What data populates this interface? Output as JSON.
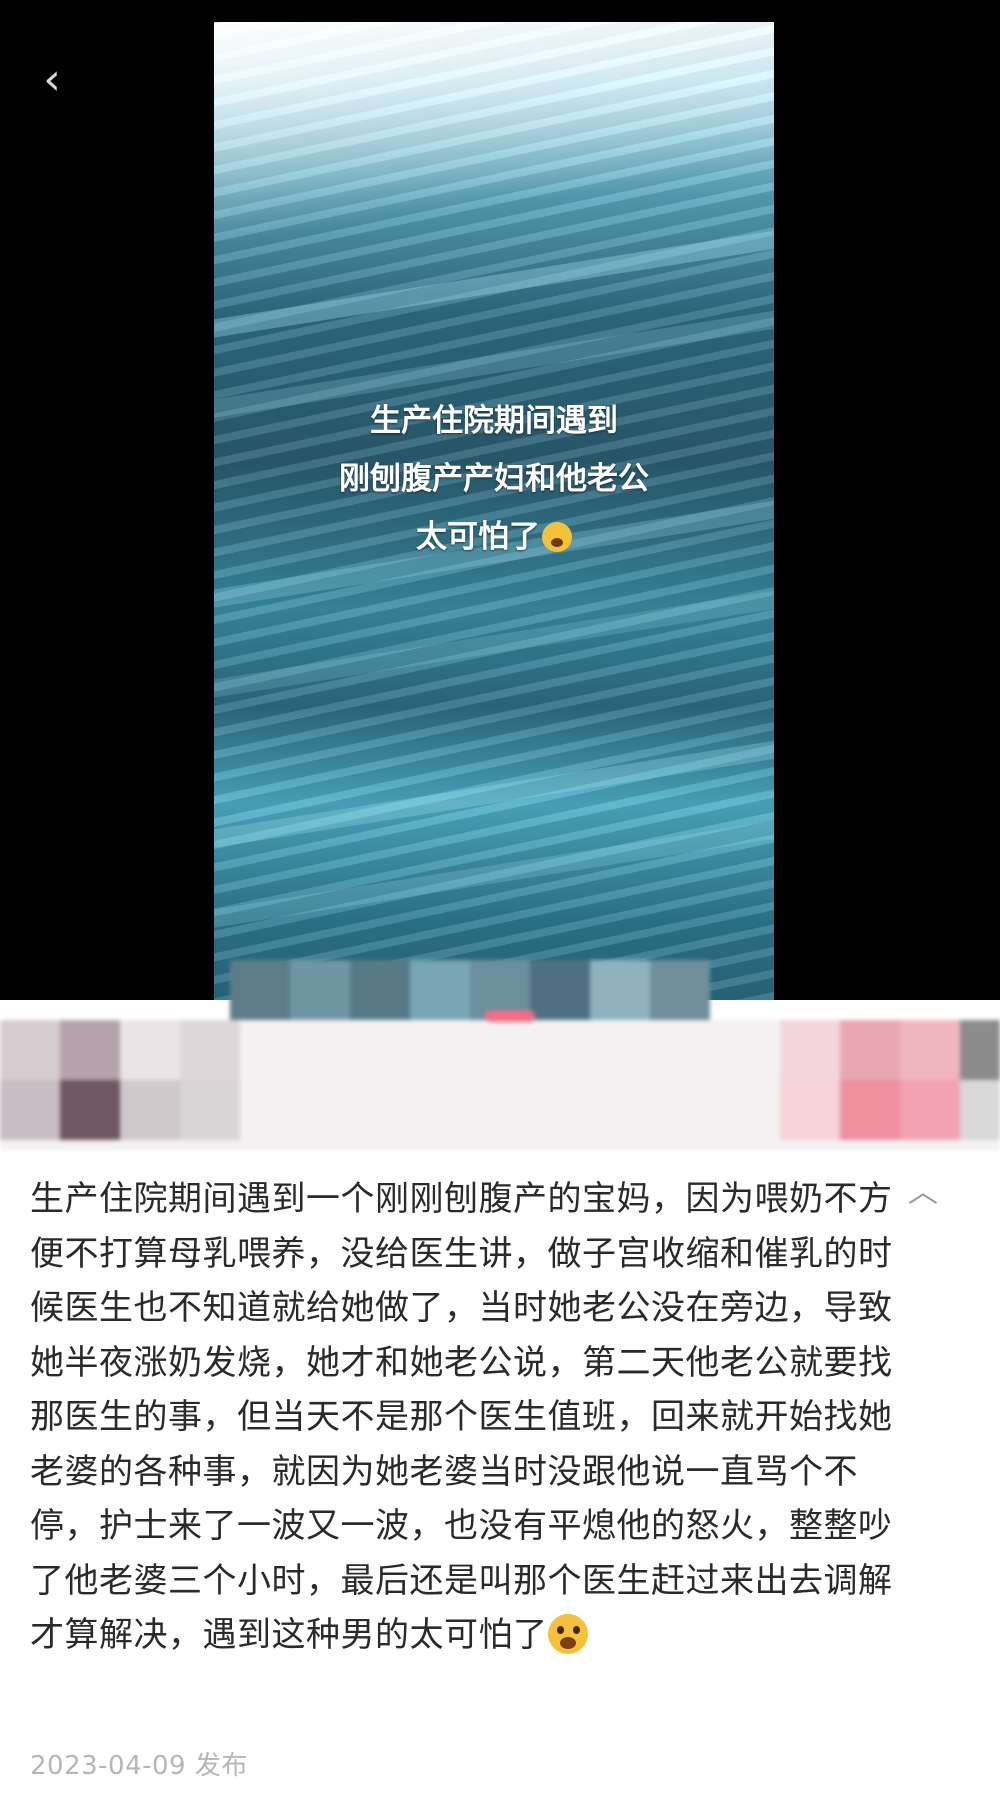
{
  "header": {
    "back_icon": "chevron-left-icon"
  },
  "video": {
    "caption_lines": [
      "生产住院期间遇到",
      "刚刨腹产产妇和他老公",
      "太可怕了"
    ],
    "caption_emoji": "screaming-face-icon"
  },
  "post": {
    "text": "生产住院期间遇到一个刚刚刨腹产的宝妈，因为喂奶不方便不打算母乳喂养，没给医生讲，做子宫收缩和催乳的时候医生也不知道就给她做了，当时她老公没在旁边，导致她半夜涨奶发烧，她才和她老公说，第二天他老公就要找那医生的事，但当天不是那个医生值班，回来就开始找她老婆的各种事，就因为她老婆当时没跟他说一直骂个不停，护士来了一波又一波，也没有平熄他的怒火，整整吵了他老婆三个小时，最后还是叫那个医生赶过来出去调解才算解决，遇到这种男的太可怕了",
    "text_emoji": "screaming-face-icon",
    "collapse_icon": "chevron-up-icon",
    "date": "2023-04-09 发布"
  }
}
